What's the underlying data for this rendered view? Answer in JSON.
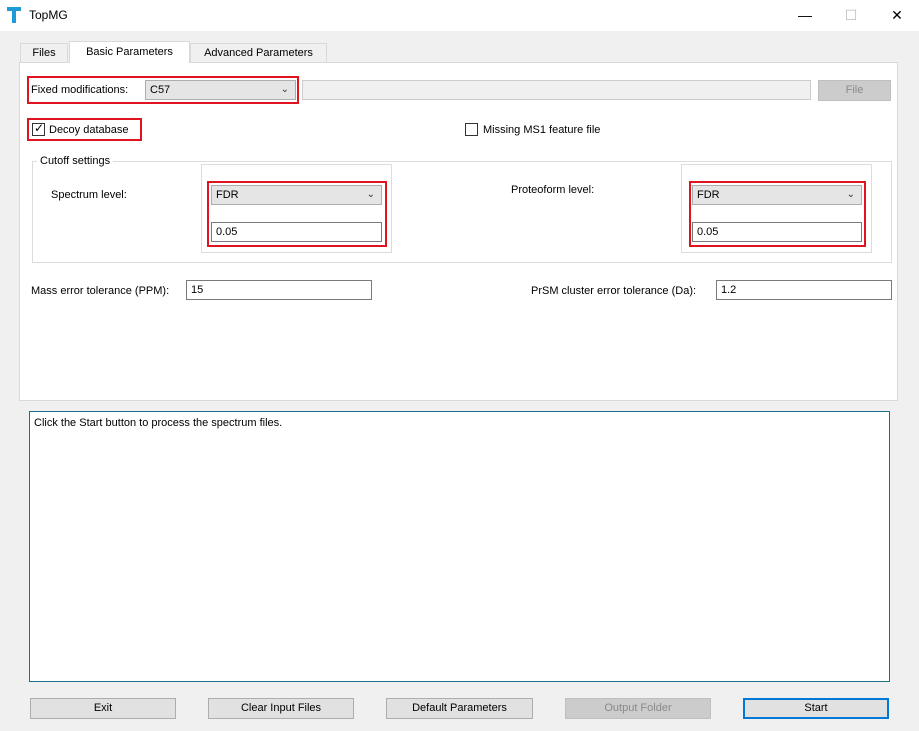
{
  "window": {
    "title": "TopMG",
    "minimize_glyph": "—",
    "maximize_glyph": "☐",
    "close_glyph": "✕"
  },
  "tabs": [
    {
      "label": "Files"
    },
    {
      "label": "Basic Parameters"
    },
    {
      "label": "Advanced Parameters"
    }
  ],
  "basic": {
    "fixed_mod_label": "Fixed modifications:",
    "fixed_mod_value": "C57",
    "fixed_mod_file_path": "",
    "file_button": "File",
    "decoy_label": "Decoy database",
    "decoy_checked": true,
    "missing_ms1_label": "Missing MS1 feature file",
    "missing_ms1_checked": false,
    "cutoff_group_label": "Cutoff settings",
    "spectrum_level_label": "Spectrum level:",
    "spectrum_cutoff_type": "FDR",
    "spectrum_cutoff_value": "0.05",
    "proteoform_level_label": "Proteoform level:",
    "proteoform_cutoff_type": "FDR",
    "proteoform_cutoff_value": "0.05",
    "mass_error_label": "Mass error tolerance (PPM):",
    "mass_error_value": "15",
    "prsm_cluster_label": "PrSM cluster error tolerance (Da):",
    "prsm_cluster_value": "1.2"
  },
  "log_text": "Click the Start button to process the spectrum files.",
  "buttons": {
    "exit": "Exit",
    "clear_input": "Clear Input Files",
    "default_params": "Default Parameters",
    "output_folder": "Output Folder",
    "start": "Start"
  },
  "colors": {
    "highlight": "#e0141e",
    "accent": "#0078d7",
    "app_icon": "#1e9bd7"
  },
  "icons": {
    "dropdown": "chevron-down-icon",
    "checkmark": "checkmark-icon",
    "app": "topmg-app-icon"
  }
}
